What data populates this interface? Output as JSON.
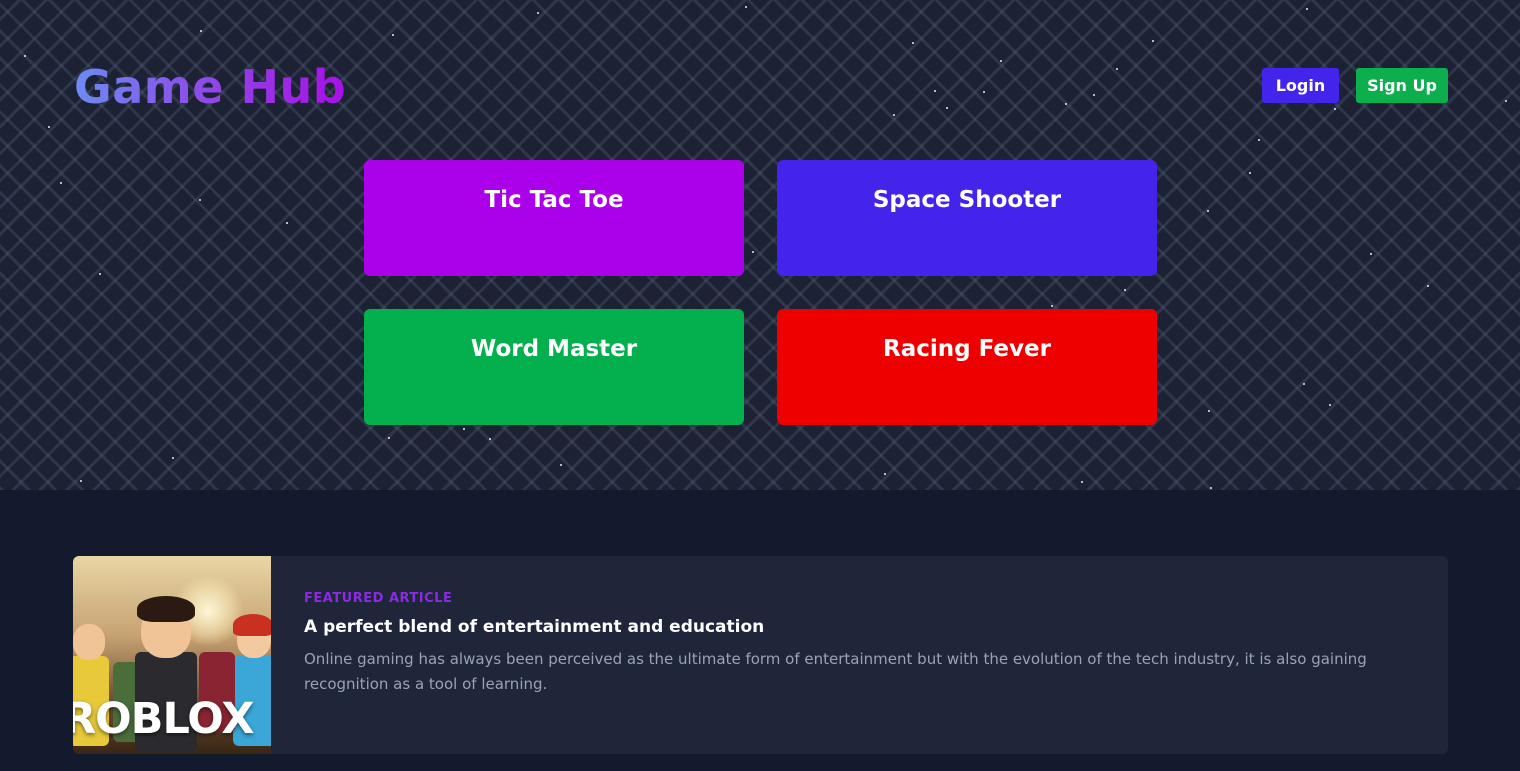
{
  "header": {
    "logo": "Game Hub",
    "login_label": "Login",
    "signup_label": "Sign Up"
  },
  "games": [
    {
      "title": "Tic Tac Toe",
      "color": "#ab00ea"
    },
    {
      "title": "Space Shooter",
      "color": "#4423ea"
    },
    {
      "title": "Word Master",
      "color": "#03b04d"
    },
    {
      "title": "Racing Fever",
      "color": "#ef0000"
    }
  ],
  "featured": {
    "tag": "FEATURED ARTICLE",
    "title": "A perfect blend of entertainment and education",
    "description": "Online gaming has always been perceived as the ultimate form of entertainment but with the evolution of the tech industry, it is also gaining recognition as a tool of learning.",
    "image_text": "ROBLOX"
  },
  "colors": {
    "accent": "#8a2be2",
    "login": "#4324ea",
    "signup": "#0cae4d",
    "background": "#141a2e"
  }
}
